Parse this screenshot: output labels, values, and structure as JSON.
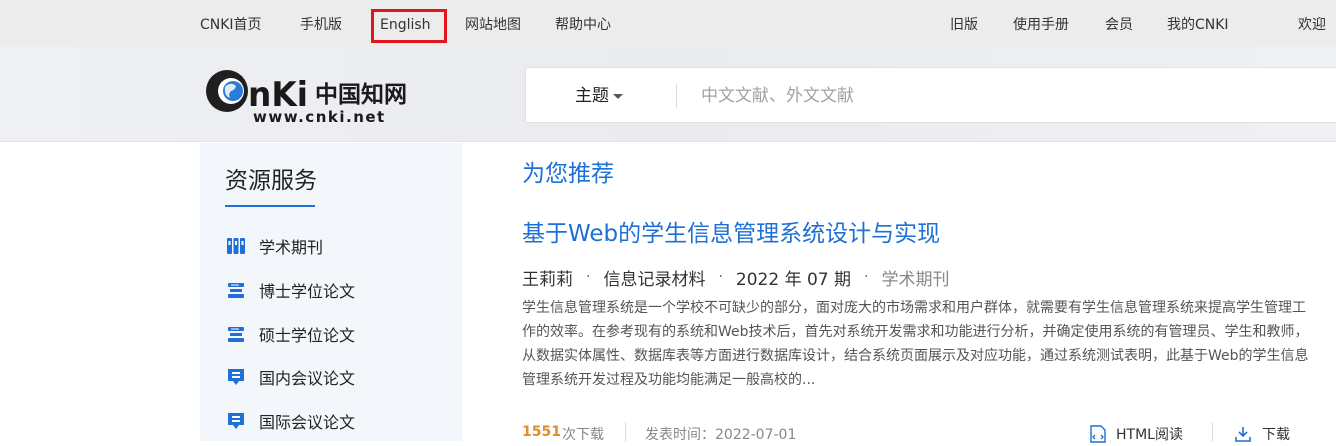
{
  "topnav": {
    "left": [
      "CNKI首页",
      "手机版",
      "English",
      "网站地图",
      "帮助中心"
    ],
    "right": [
      "旧版",
      "使用手册",
      "会员",
      "我的CNKI",
      "欢迎"
    ]
  },
  "logo": {
    "cn_text": "中国知网",
    "brand": "CNKI",
    "url_text": "www.cnki.net"
  },
  "search": {
    "scope": "主题",
    "placeholder": "中文文献、外文文献"
  },
  "sidebar": {
    "title": "资源服务",
    "items": [
      {
        "label": "学术期刊",
        "icon": "journal-icon"
      },
      {
        "label": "博士学位论文",
        "icon": "doctoral-thesis-icon"
      },
      {
        "label": "硕士学位论文",
        "icon": "master-thesis-icon"
      },
      {
        "label": "国内会议论文",
        "icon": "domestic-conference-icon"
      },
      {
        "label": "国际会议论文",
        "icon": "international-conference-icon"
      }
    ]
  },
  "main": {
    "section_title": "为您推荐",
    "article": {
      "title": "基于Web的学生信息管理系统设计与实现",
      "author": "王莉莉",
      "source": "信息记录材料",
      "issue": "2022 年 07 期",
      "type": "学术期刊",
      "abstract": "学生信息管理系统是一个学校不可缺少的部分，面对庞大的市场需求和用户群体，就需要有学生信息管理系统来提高学生管理工作的效率。在参考现有的系统和Web技术后，首先对系统开发需求和功能进行分析，并确定使用系统的有管理员、学生和教师，从数据实体属性、数据库表等方面进行数据库设计，结合系统页面展示及对应功能，通过系统测试表明，此基于Web的学生信息管理系统开发过程及功能均能满足一般高校的...",
      "downloads": "1551",
      "downloads_unit": "次下载",
      "pub_date": "发表时间：2022-07-01",
      "html_read": "HTML阅读",
      "download": "下载"
    }
  },
  "colors": {
    "accent": "#1e6fd6",
    "highlight_box": "#e3141c",
    "download_count": "#e38b2c"
  }
}
